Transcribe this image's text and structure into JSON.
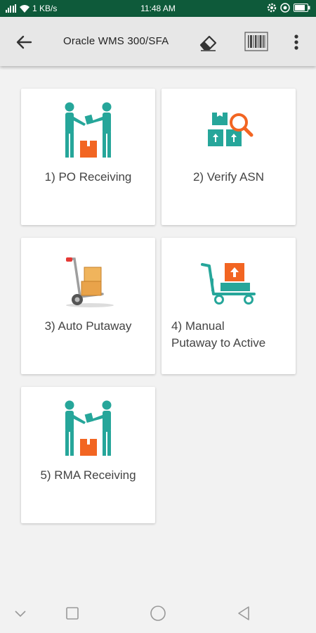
{
  "status_bar": {
    "network_speed": "1 KB/s",
    "time": "11:48 AM"
  },
  "app_bar": {
    "title": "Oracle WMS 300/SFA",
    "icons": [
      "back-arrow-icon",
      "eraser-icon",
      "barcode-icon",
      "more-vert-icon"
    ]
  },
  "tiles": [
    {
      "label": "1) PO Receiving",
      "icon": "people-handoff-box-icon"
    },
    {
      "label": "2) Verify ASN",
      "icon": "boxes-magnifier-icon"
    },
    {
      "label": "3) Auto Putaway",
      "icon": "hand-truck-boxes-icon"
    },
    {
      "label_line1": "4) Manual",
      "label_line2": "Putaway to Active",
      "icon": "cart-box-icon"
    },
    {
      "label": "5) RMA Receiving",
      "icon": "people-handoff-box-icon"
    }
  ],
  "colors": {
    "status_bar": "#0e5a3a",
    "app_bar": "#e7e7e7",
    "teal": "#26a69a",
    "orange": "#f26522"
  },
  "nav_bar": {
    "icons": [
      "chevron-down-icon",
      "recents-square-icon",
      "home-circle-icon",
      "back-triangle-icon"
    ]
  }
}
